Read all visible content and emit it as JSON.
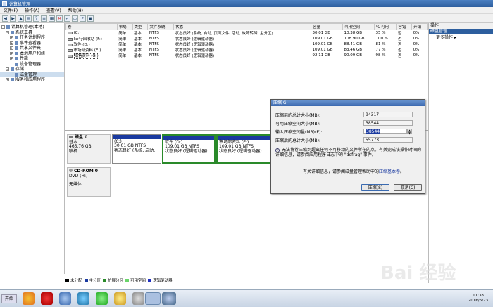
{
  "window": {
    "title": "计算机管理"
  },
  "menu": [
    "文件(F)",
    "操作(A)",
    "查看(V)",
    "帮助(H)"
  ],
  "tree": [
    {
      "label": "计算机管理(本地)",
      "indent": 0
    },
    {
      "label": "系统工具",
      "indent": 1
    },
    {
      "label": "任务计划程序",
      "indent": 2
    },
    {
      "label": "事件查看器",
      "indent": 2
    },
    {
      "label": "共享文件夹",
      "indent": 2
    },
    {
      "label": "本地用户和组",
      "indent": 2
    },
    {
      "label": "性能",
      "indent": 2
    },
    {
      "label": "设备管理器",
      "indent": 2
    },
    {
      "label": "存储",
      "indent": 1
    },
    {
      "label": "磁盘管理",
      "indent": 2
    },
    {
      "label": "服务和应用程序",
      "indent": 1
    }
  ],
  "volume_table": {
    "headers": [
      "卷",
      "布局",
      "类型",
      "文件系统",
      "状态",
      "容量",
      "可用空间",
      "% 可用",
      "容错",
      "开销"
    ],
    "rows": [
      [
        "(C:)",
        "简单",
        "基本",
        "NTFS",
        "状态良好 (系统, 启动, 页面文件, 活动, 故障转储, 主分区)",
        "30.01 GB",
        "10.38 GB",
        "35 %",
        "否",
        "0%"
      ],
      [
        "ku4y回收站 (F:)",
        "简单",
        "基本",
        "NTFS",
        "状态良好 (逻辑驱动器)",
        "109.01 GB",
        "108.90 GB",
        "100 %",
        "否",
        "0%"
      ],
      [
        "软件 (D:)",
        "简单",
        "基本",
        "NTFS",
        "状态良好 (逻辑驱动器)",
        "109.01 GB",
        "88.41 GB",
        "81 %",
        "否",
        "0%"
      ],
      [
        "市场部资料 (E:)",
        "简单",
        "基本",
        "NTFS",
        "状态良好 (逻辑驱动器)",
        "109.01 GB",
        "83.46 GB",
        "77 %",
        "否",
        "0%"
      ],
      [
        "销售资料 (G:)",
        "简单",
        "基本",
        "NTFS",
        "状态良好 (逻辑驱动器)",
        "92.11 GB",
        "90.09 GB",
        "98 %",
        "否",
        "0%"
      ]
    ]
  },
  "disk0": {
    "name": "磁盘 0",
    "type": "基本",
    "size": "465.76 GB",
    "status": "联机"
  },
  "partitions": [
    {
      "name": "(C:)",
      "size": "30.01 GB NTFS",
      "status": "状态良好 (系统, 启动,"
    },
    {
      "name": "软件  (D:)",
      "size": "109.01 GB NTFS",
      "status": "状态良好 (逻辑驱动器)"
    },
    {
      "name": "市场部资料  (E:)",
      "size": "109.01 GB NTFS",
      "status": "状态良好 (逻辑驱动器)"
    }
  ],
  "cdrom": {
    "name": "CD-ROM 0",
    "type": "DVD (H:)",
    "status": "无媒体"
  },
  "legend": [
    {
      "label": "未分配",
      "color": "#000000"
    },
    {
      "label": "主分区",
      "color": "#1a3aa0"
    },
    {
      "label": "扩展分区",
      "color": "#2a8a2a"
    },
    {
      "label": "可用空间",
      "color": "#6ad46a"
    },
    {
      "label": "逻辑驱动器",
      "color": "#2030c0"
    }
  ],
  "actions": {
    "header": "操作",
    "selected": "磁盘管理",
    "more": "更多操作"
  },
  "dialog": {
    "title": "压缩 G:",
    "total_before_label": "压缩前的总计大小(MB):",
    "total_before": "94317",
    "available_label": "可用压缩空间大小(MB):",
    "available": "38544",
    "input_label": "输入压缩空间量(MB)(E):",
    "input": "38544",
    "total_after_label": "压缩后的总计大小(MB):",
    "total_after": "55773",
    "note": "无法将卷压缩到超出任何不可移动的文件所在的点。有关完成该操作时间的详细信息，请参阅应用程序日志中的 \"defrag\" 事件。",
    "more_info_prefix": "有关详细信息，请参阅磁盘管理帮助中的",
    "more_info_link": "压缩基本卷",
    "more_info_suffix": "。",
    "compress_button": "压缩(S)",
    "cancel_button": "取消(C)"
  },
  "taskbar": {
    "start": "开始",
    "time": "11:38",
    "date": "2016/6/23"
  },
  "watermark": "Bai 经验",
  "colors": {
    "primary_partition": "#1a3aa0",
    "title_bar": "#2d5e9e"
  }
}
